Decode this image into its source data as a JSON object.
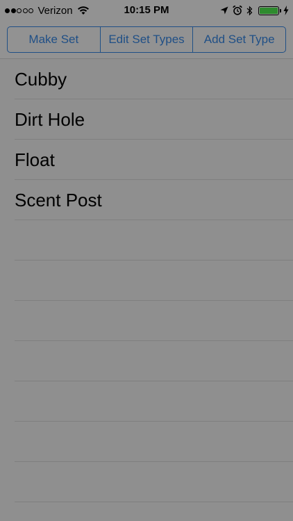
{
  "status_bar": {
    "signal": {
      "filled": 2,
      "total": 5
    },
    "carrier": "Verizon",
    "time": "10:15 PM",
    "icons": [
      "wifi-icon",
      "location-arrow-icon",
      "alarm-icon",
      "bluetooth-icon",
      "battery-icon",
      "charging-bolt-icon"
    ],
    "battery_level": 1.0,
    "battery_color": "#2e8b2e"
  },
  "segmented_control": {
    "segments": [
      {
        "label": "Make Set"
      },
      {
        "label": "Edit Set Types"
      },
      {
        "label": "Add Set Type"
      }
    ],
    "tint_color": "#1f4f86"
  },
  "list": {
    "items": [
      {
        "label": "Cubby"
      },
      {
        "label": "Dirt Hole"
      },
      {
        "label": "Float"
      },
      {
        "label": "Scent Post"
      },
      {
        "label": ""
      },
      {
        "label": ""
      },
      {
        "label": ""
      },
      {
        "label": ""
      },
      {
        "label": ""
      },
      {
        "label": ""
      },
      {
        "label": ""
      },
      {
        "label": ""
      }
    ]
  }
}
